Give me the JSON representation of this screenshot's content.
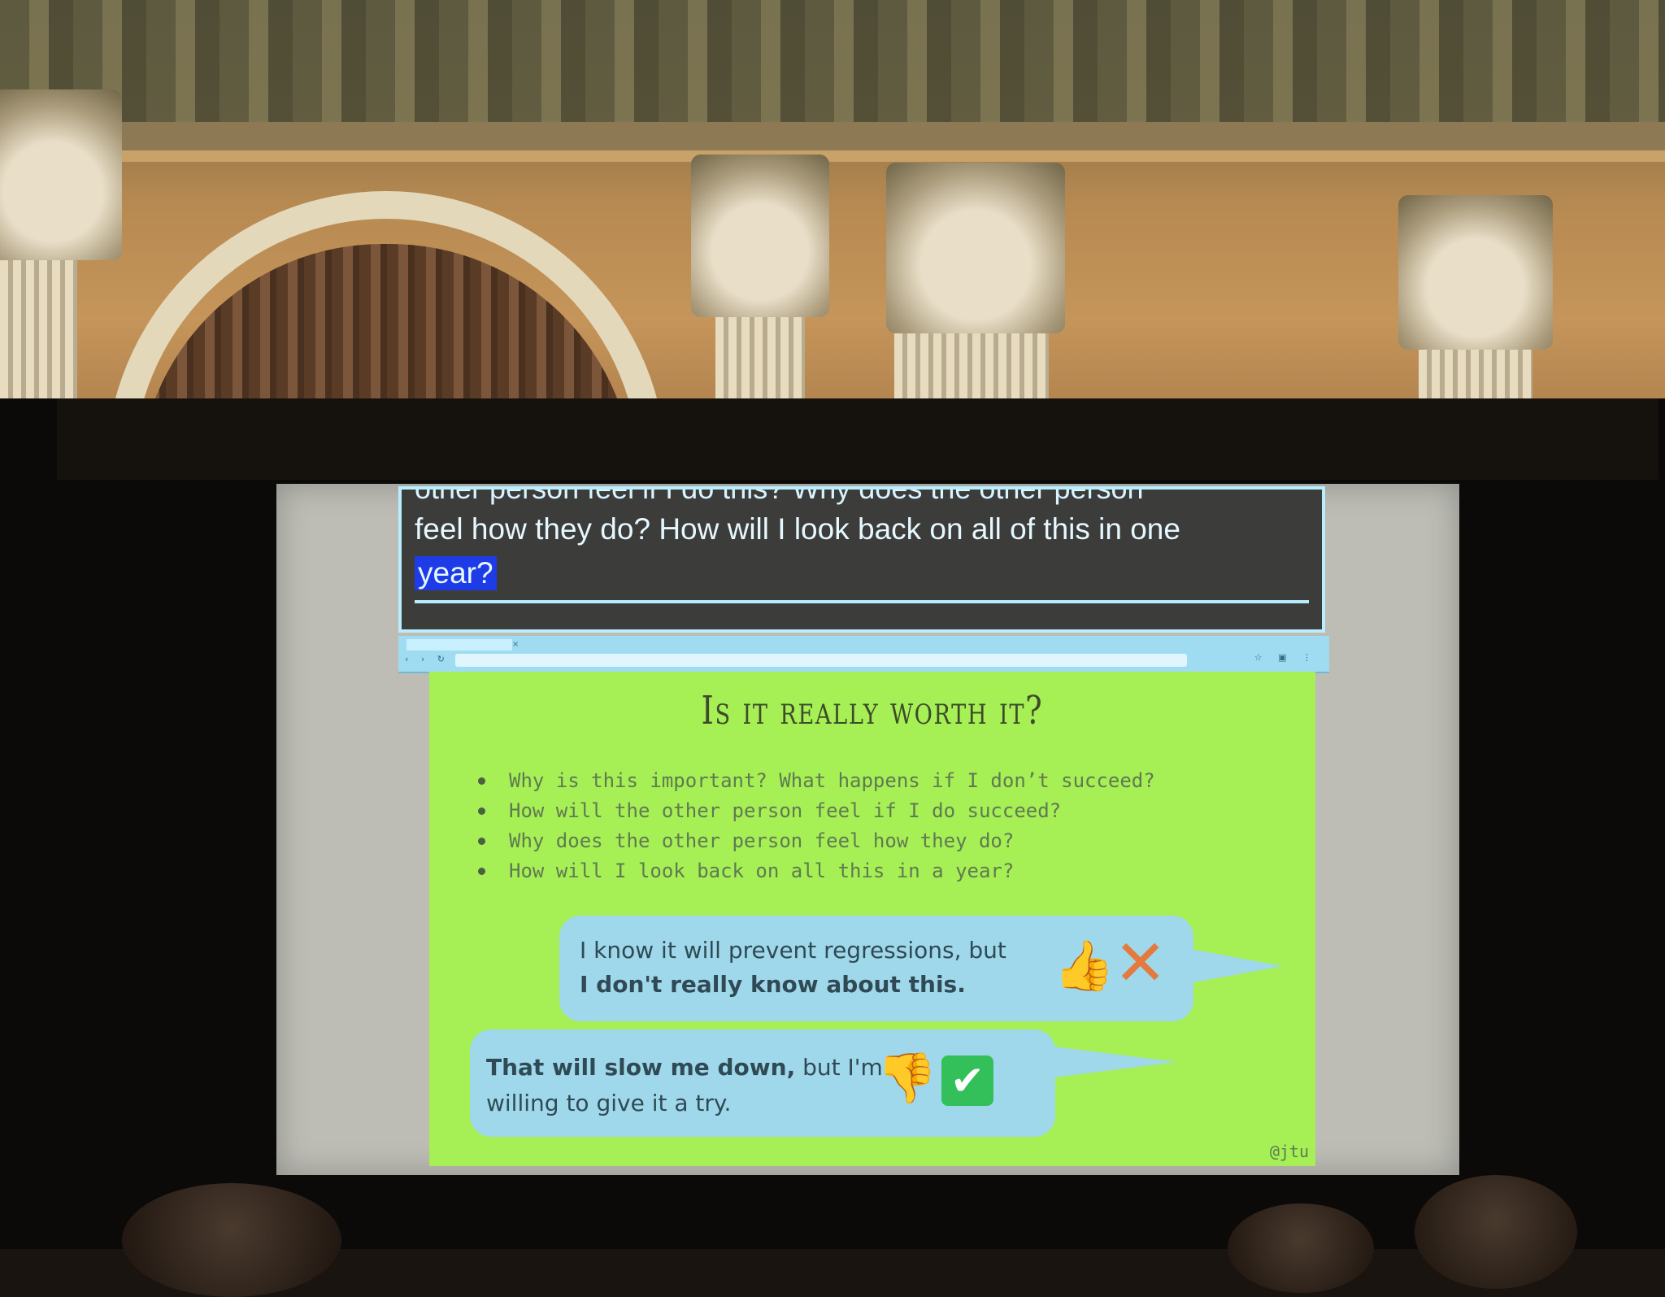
{
  "caption": {
    "cut_line": "other person feel if I do this? Why does the other person",
    "line": "feel how they do? How will I look back on all of this in one",
    "highlighted": "year?"
  },
  "slide": {
    "title": "Is it really worth it?",
    "bullets": [
      "Why is this important? What happens if I don’t succeed?",
      "How will the other person feel if I do succeed?",
      "Why does the other person feel how they do?",
      "How will I look back on all this in a year?"
    ],
    "bubble1": {
      "line1": "I know it will prevent regressions, but",
      "line2": "I don't really know about this."
    },
    "bubble2": {
      "line1_bold": "That will slow me down,",
      "line1_rest": " but I'm",
      "line2": "willing to give it a try."
    },
    "handle": "@jtu"
  },
  "icons": {
    "thumb_up": "thumbs-up-icon",
    "x_mark": "x-mark-icon",
    "thumb_down": "thumbs-down-icon",
    "check": "checkmark-icon"
  },
  "colors": {
    "slide_bg": "#a6ef55",
    "bubble": "#9fd8ea",
    "caption_highlight": "#1e3be8"
  }
}
